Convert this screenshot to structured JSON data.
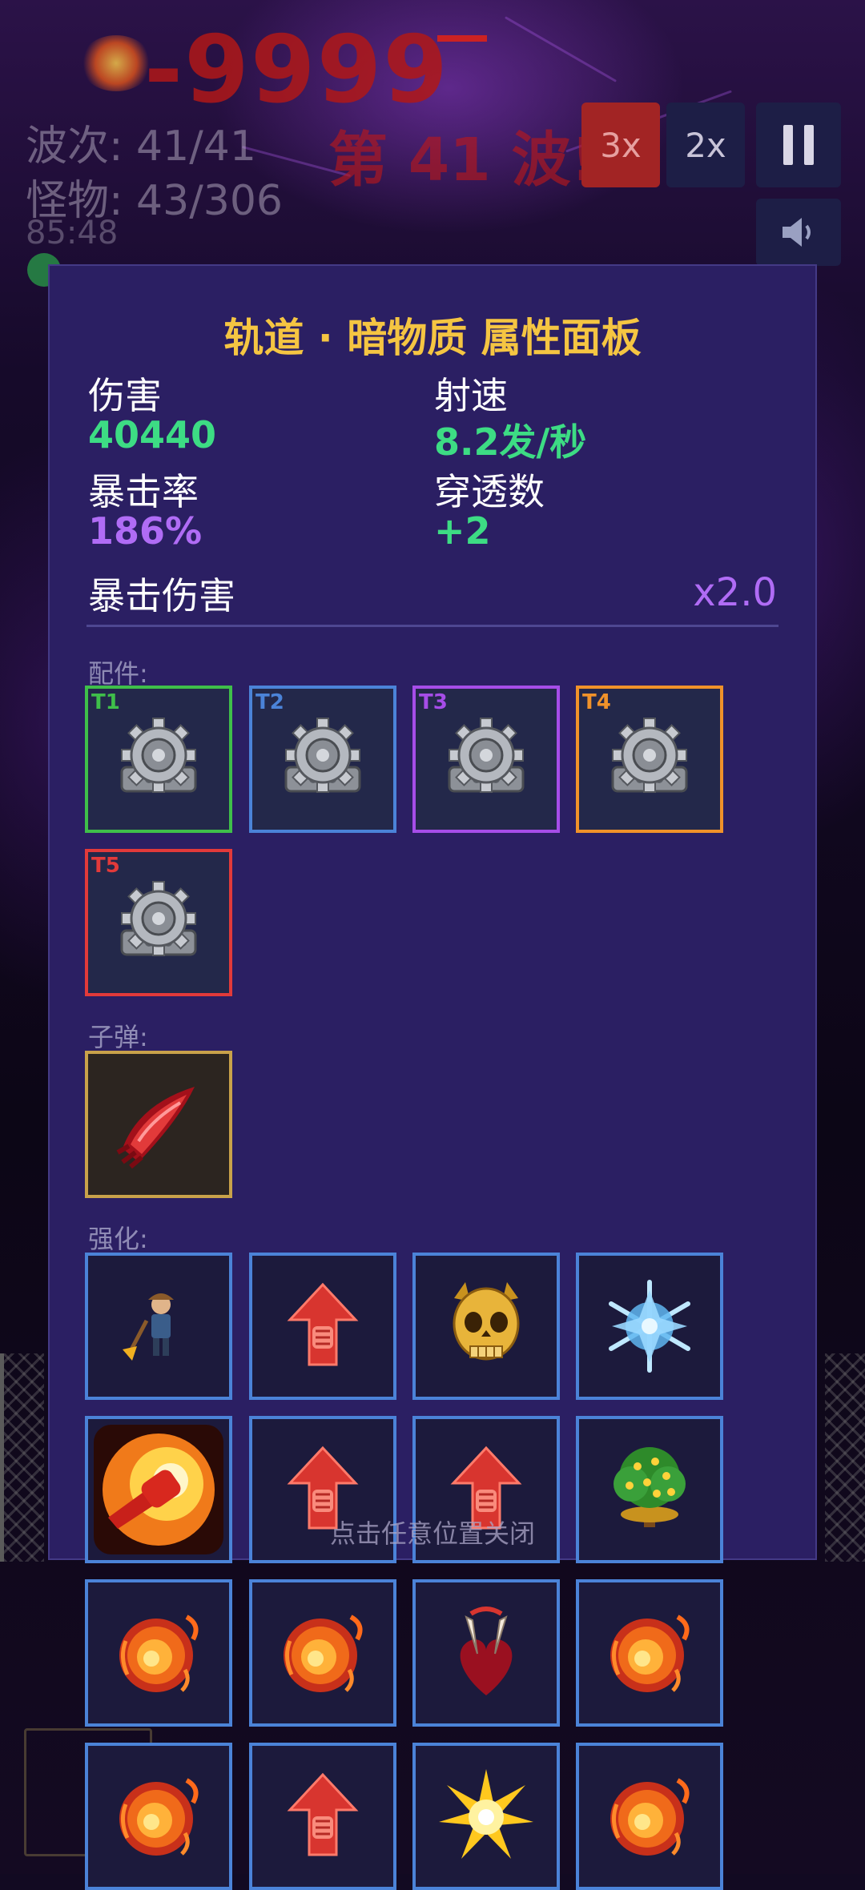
{
  "hud": {
    "damage_popup": "-9999",
    "wave_counter": "波次: 41/41",
    "monster_counter": "怪物: 43/306",
    "timer": "85:48",
    "wave_banner": "第 41 波!"
  },
  "speed_controls": {
    "speed_3x": "3x",
    "speed_2x": "2x"
  },
  "panel": {
    "title": "轨道 · 暗物质 属性面板",
    "stats": {
      "damage_label": "伤害",
      "damage_value": "40440",
      "fire_rate_label": "射速",
      "fire_rate_value": "8.2发/秒",
      "crit_rate_label": "暴击率",
      "crit_rate_value": "186%",
      "pierce_label": "穿透数",
      "pierce_value": "+2",
      "crit_damage_label": "暴击伤害",
      "crit_damage_value": "x2.0"
    },
    "sections": {
      "parts": "配件:",
      "bullet": "子弹:",
      "enhance": "强化:"
    },
    "parts": [
      {
        "tier": "T1",
        "color": "#3fbf4a",
        "icon": "gear-engine-icon"
      },
      {
        "tier": "T2",
        "color": "#4b83d8",
        "icon": "gear-engine-icon"
      },
      {
        "tier": "T3",
        "color": "#a64de8",
        "icon": "gear-engine-icon"
      },
      {
        "tier": "T4",
        "color": "#f0922a",
        "icon": "gear-engine-icon"
      },
      {
        "tier": "T5",
        "color": "#e23a3a",
        "icon": "gear-engine-icon"
      }
    ],
    "bullet": {
      "icon": "red-blade-icon",
      "color": "#c9a24a"
    },
    "enhancements": [
      "miner-icon",
      "fist-arrow-icon",
      "golden-skull-icon",
      "snowflake-icon",
      "fire-fist-icon",
      "fist-arrow-icon",
      "fist-arrow-icon",
      "money-tree-icon",
      "fireball-icon",
      "fireball-icon",
      "fang-heart-icon",
      "fireball-icon",
      "fireball-icon",
      "fist-arrow-icon",
      "star-burst-icon",
      "fireball-icon"
    ],
    "close_hint": "点击任意位置关闭"
  },
  "colors": {
    "panel_bg": "#2b1f63",
    "title": "#f5c542",
    "green_value": "#3ddc84",
    "purple_value": "#b06cf5",
    "enhance_border": "#4b83d8"
  }
}
